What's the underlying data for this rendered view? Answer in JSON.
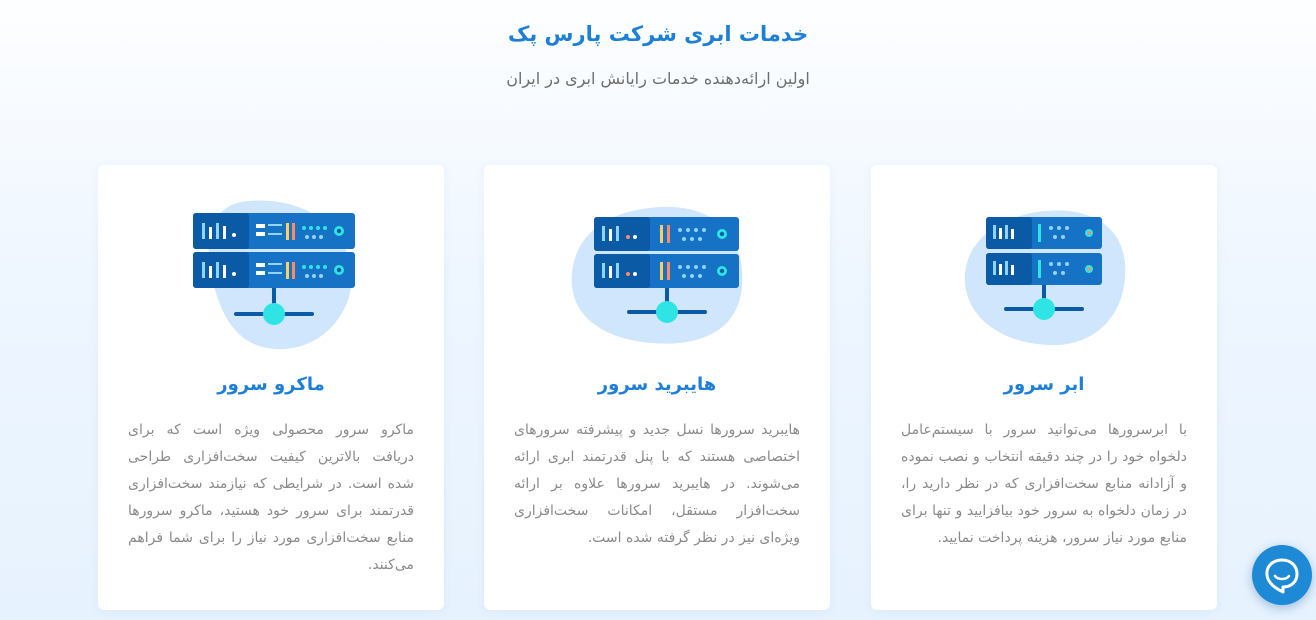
{
  "header": {
    "title": "خدمات ابری شرکت پارس پک",
    "subtitle": "اولین ارائه‌دهنده خدمات رایانش ابری در ایران"
  },
  "cards": [
    {
      "title": "ابر سرور",
      "description": "با ابرسرورها می‌توانید سرور با سیستم‌عامل دلخواه خود را در چند دقیقه انتخاب و نصب نموده و آزادانه منابع سخت‌افزاری که در نظر دارید را، در زمان دلخواه به سرور خود بیافزایید و تنها برای منابع مورد نیاز سرور، هزینه پرداخت نمایید.",
      "icon": "cloud-server-icon"
    },
    {
      "title": "هایبرید سرور",
      "description": "هایبرید سرورها نسل جدید و پیشرفته سرورهای اختصاصی هستند که با پنل قدرتمند ابری ارائه می‌شوند. در هایبرید سرورها علاوه بر ارائه سخت‌افزار مستقل، امکانات سخت‌افزاری ویژه‌ای نیز در نظر گرفته شده است.",
      "icon": "hybrid-server-icon"
    },
    {
      "title": "ماکرو سرور",
      "description": "ماکرو سرور محصولی ویژه است که برای دریافت بالاترین کیفیت سخت‌افزاری طراحی شده است. در شرایطی که نیازمند سخت‌افزاری قدرتمند برای سرور خود هستید، ماکرو سرورها منابع سخت‌افزاری مورد نیاز را برای شما فراهم می‌کنند.",
      "icon": "macro-server-icon"
    }
  ],
  "chat": {
    "icon": "chat-bubble-icon"
  },
  "colors": {
    "accent": "#1e7fd6",
    "server_dark": "#0b5aa6",
    "server_body": "#1672c4",
    "blob": "#cfe6fd",
    "node": "#2ee4e4",
    "text_muted": "#8a8a8a"
  }
}
